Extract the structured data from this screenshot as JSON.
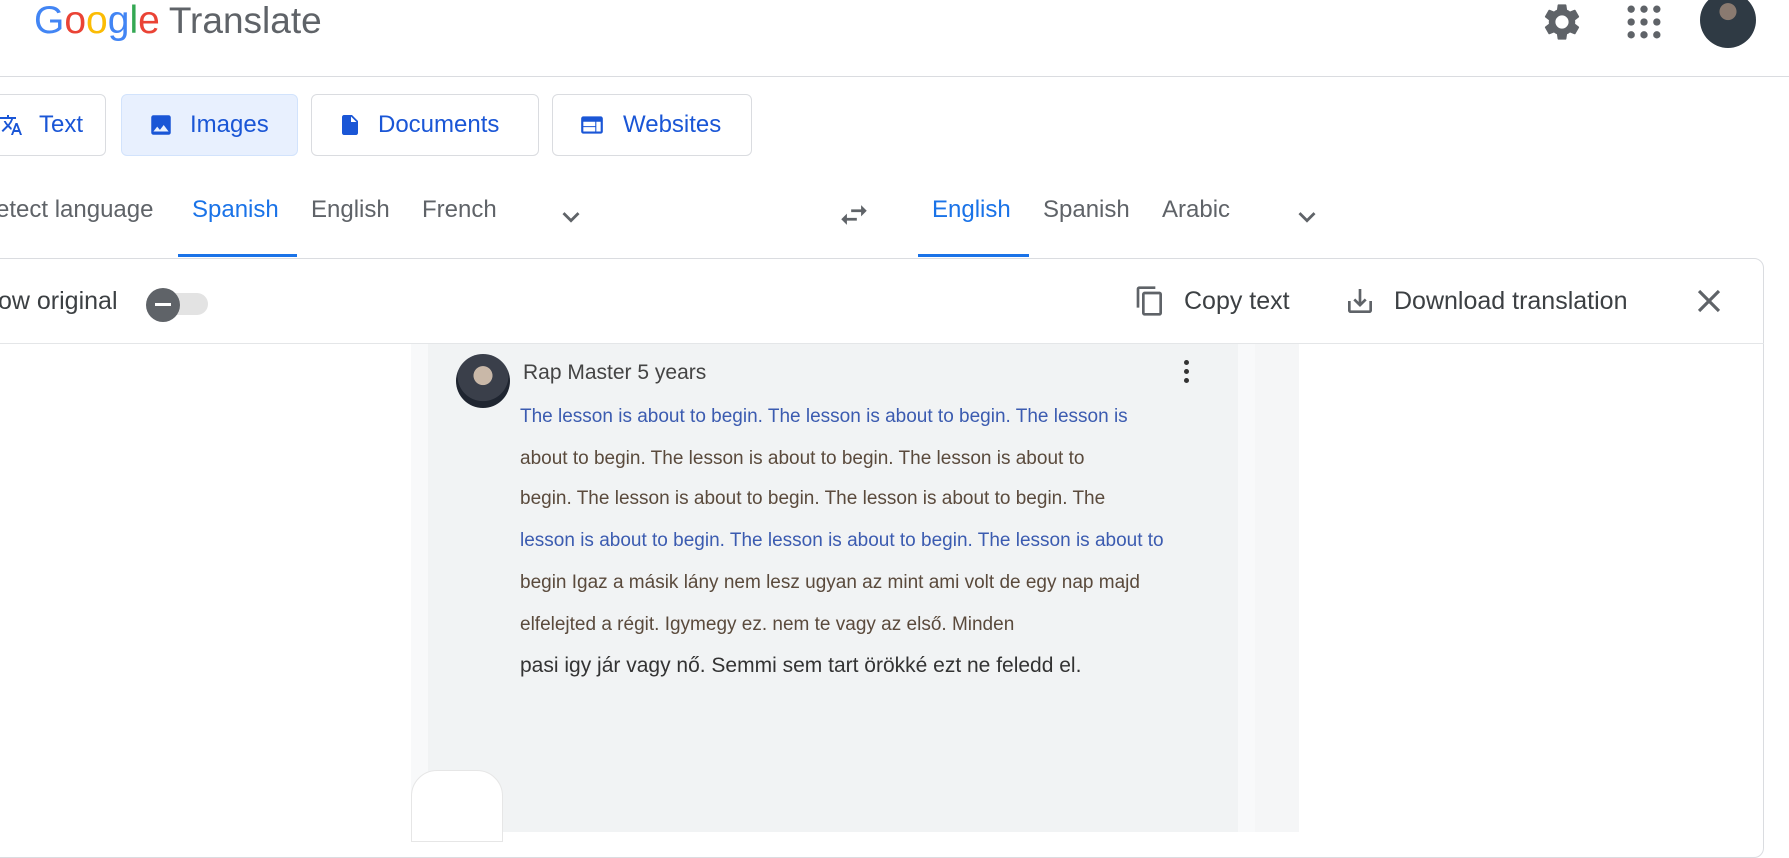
{
  "app": {
    "logo_letters": [
      "G",
      "o",
      "o",
      "g",
      "l",
      "e"
    ],
    "product_name": "Translate"
  },
  "header": {
    "icons": [
      "menu-icon",
      "settings-icon",
      "apps-grid-icon",
      "account-avatar"
    ]
  },
  "mode_tabs": [
    {
      "label": "Text",
      "icon": "translate-icon",
      "active": false
    },
    {
      "label": "Images",
      "icon": "image-icon",
      "active": true
    },
    {
      "label": "Documents",
      "icon": "document-icon",
      "active": false
    },
    {
      "label": "Websites",
      "icon": "website-icon",
      "active": false
    }
  ],
  "source_languages": {
    "items": [
      "etect language",
      "Spanish",
      "English",
      "French"
    ],
    "selected": "Spanish"
  },
  "target_languages": {
    "items": [
      "English",
      "Spanish",
      "Arabic"
    ],
    "selected": "English"
  },
  "result_toolbar": {
    "show_original_label": "ow original",
    "show_original_on": false,
    "copy_label": "Copy text",
    "download_label": "Download translation"
  },
  "translated_image": {
    "author_line": "Rap Master 5 years",
    "lines": [
      "The lesson is about to begin. The lesson is about to begin. The lesson is",
      "about to begin. The lesson is about to begin. The lesson is about to",
      "begin. The lesson is about to begin. The lesson is about to begin. The",
      "lesson is about to begin. The lesson is about to begin. The lesson is about to",
      "begin Igaz a másik lány nem lesz ugyan az mint ami volt de egy nap majd",
      "elfelejted a régit. Igymegy ez. nem te vagy az első. Minden",
      "pasi igy jár vagy nő. Semmi sem tart örökké ezt ne feledd el."
    ]
  },
  "colors": {
    "accent": "#1a73e8",
    "tab_text": "#1a56d6",
    "active_tab_bg": "#e8f0fe",
    "border": "#dadce0"
  }
}
